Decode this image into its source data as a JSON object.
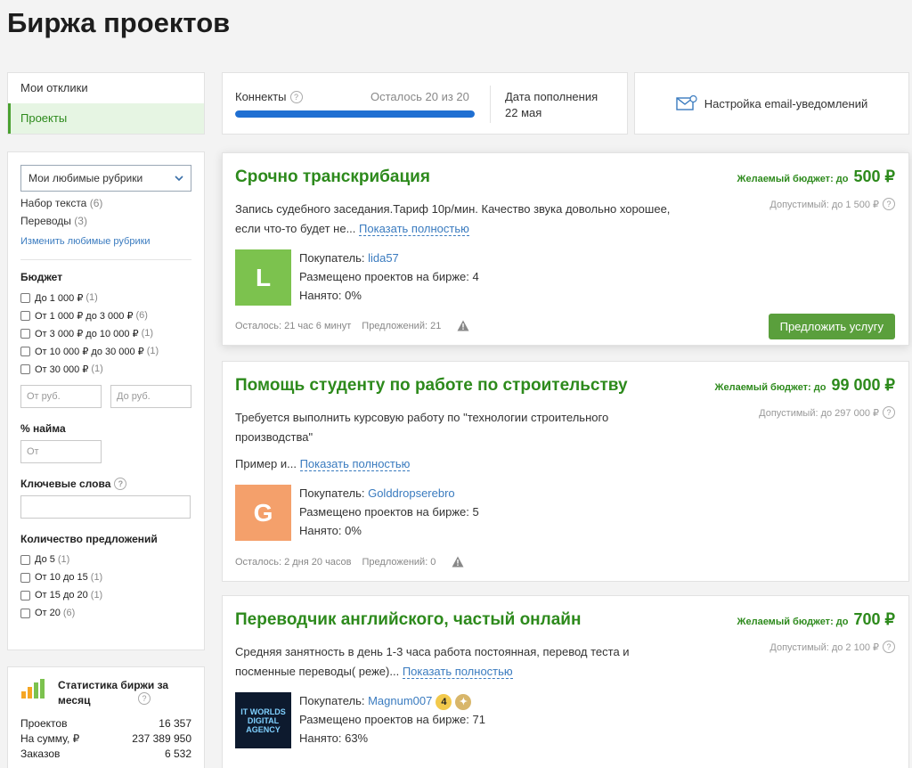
{
  "page": {
    "title": "Биржа проектов"
  },
  "nav": {
    "items": [
      {
        "label": "Мои отклики"
      },
      {
        "label": "Проекты"
      }
    ]
  },
  "filters": {
    "select_value": "Мои любимые рубрики",
    "categories": [
      {
        "label": "Набор текста",
        "count": "(6)"
      },
      {
        "label": "Переводы",
        "count": "(3)"
      }
    ],
    "edit_link": "Изменить любимые рубрики",
    "budget_heading": "Бюджет",
    "budget_options": [
      {
        "label": "До 1 000 ₽",
        "count": "(1)"
      },
      {
        "label": "От 1 000 ₽ до 3 000 ₽",
        "count": "(6)"
      },
      {
        "label": "От 3 000 ₽ до 10 000 ₽",
        "count": "(1)"
      },
      {
        "label": "От 10 000 ₽ до 30 000 ₽",
        "count": "(1)"
      },
      {
        "label": "От 30 000 ₽",
        "count": "(1)"
      }
    ],
    "from_placeholder": "От руб.",
    "to_placeholder": "До руб.",
    "hire_heading": "% найма",
    "hire_placeholder": "От",
    "keywords_heading": "Ключевые слова",
    "offers_heading": "Количество предложений",
    "offers_options": [
      {
        "label": "До 5",
        "count": "(1)"
      },
      {
        "label": "От 10 до 15",
        "count": "(1)"
      },
      {
        "label": "От 15 до 20",
        "count": "(1)"
      },
      {
        "label": "От 20",
        "count": "(6)"
      }
    ]
  },
  "stats": {
    "title": "Статистика биржи за месяц",
    "rows": [
      {
        "label": "Проектов",
        "value": "16 357"
      },
      {
        "label": "На сумму, ₽",
        "value": "237 389 950"
      },
      {
        "label": "Заказов",
        "value": "6 532"
      }
    ]
  },
  "connects": {
    "label": "Коннекты",
    "remaining": "Осталось 20 из 20",
    "progress_fraction": 1.0,
    "refill_label": "Дата пополнения",
    "refill_date": "22 мая"
  },
  "email_settings": {
    "label": "Настройка email-уведомлений"
  },
  "projects": [
    {
      "title": "Срочно транскрибация",
      "budget_label": "Желаемый бюджет: до",
      "budget_value": "500 ₽",
      "allowed": "Допустимый: до 1 500 ₽",
      "description": "Запись судебного заседания.Тариф 10р/мин. Качество звука довольно хорошее, если что-то будет не...",
      "show_more": "Показать полностью",
      "avatar_letter": "L",
      "avatar_color": "#7cc24e",
      "buyer_prefix": "Покупатель:",
      "buyer_name": "lida57",
      "placed": "Размещено проектов на бирже: 4",
      "hired": "Нанято: 0%",
      "time_left": "Осталось: 21 час 6 минут",
      "offers": "Предложений: 21",
      "button": "Предложить услугу"
    },
    {
      "title": "Помощь студенту по работе по строительству",
      "budget_label": "Желаемый бюджет: до",
      "budget_value": "99 000 ₽",
      "allowed": "Допустимый: до 297 000 ₽",
      "description": "Требуется выполнить курсовую работу по \"технологии строительного производства\"",
      "description2": "Пример и...",
      "show_more": "Показать полностью",
      "avatar_letter": "G",
      "avatar_color": "#f4a06b",
      "buyer_prefix": "Покупатель:",
      "buyer_name": "Golddropserebro",
      "placed": "Размещено проектов на бирже: 5",
      "hired": "Нанято: 0%",
      "time_left": "Осталось: 2 дня 20 часов",
      "offers": "Предложений: 0"
    },
    {
      "title": "Переводчик английского, частый онлайн",
      "budget_label": "Желаемый бюджет: до",
      "budget_value": "700 ₽",
      "allowed": "Допустимый: до 2 100 ₽",
      "description": "Средняя занятность в день 1-3 часа работа постоянная, перевод теста и посменные переводы( реже)...",
      "show_more": "Показать полностью",
      "avatar_text": "IT WORLDS DIGITAL AGENCY",
      "buyer_prefix": "Покупатель:",
      "buyer_name": "Magnum007",
      "badge_level": "4",
      "placed": "Размещено проектов на бирже: 71",
      "hired": "Нанято: 63%"
    }
  ],
  "colors": {
    "accent_green": "#2d8a1c",
    "link_blue": "#3a7bbf",
    "progress_blue": "#1f6fd2",
    "button_green": "#5a9f3c"
  }
}
